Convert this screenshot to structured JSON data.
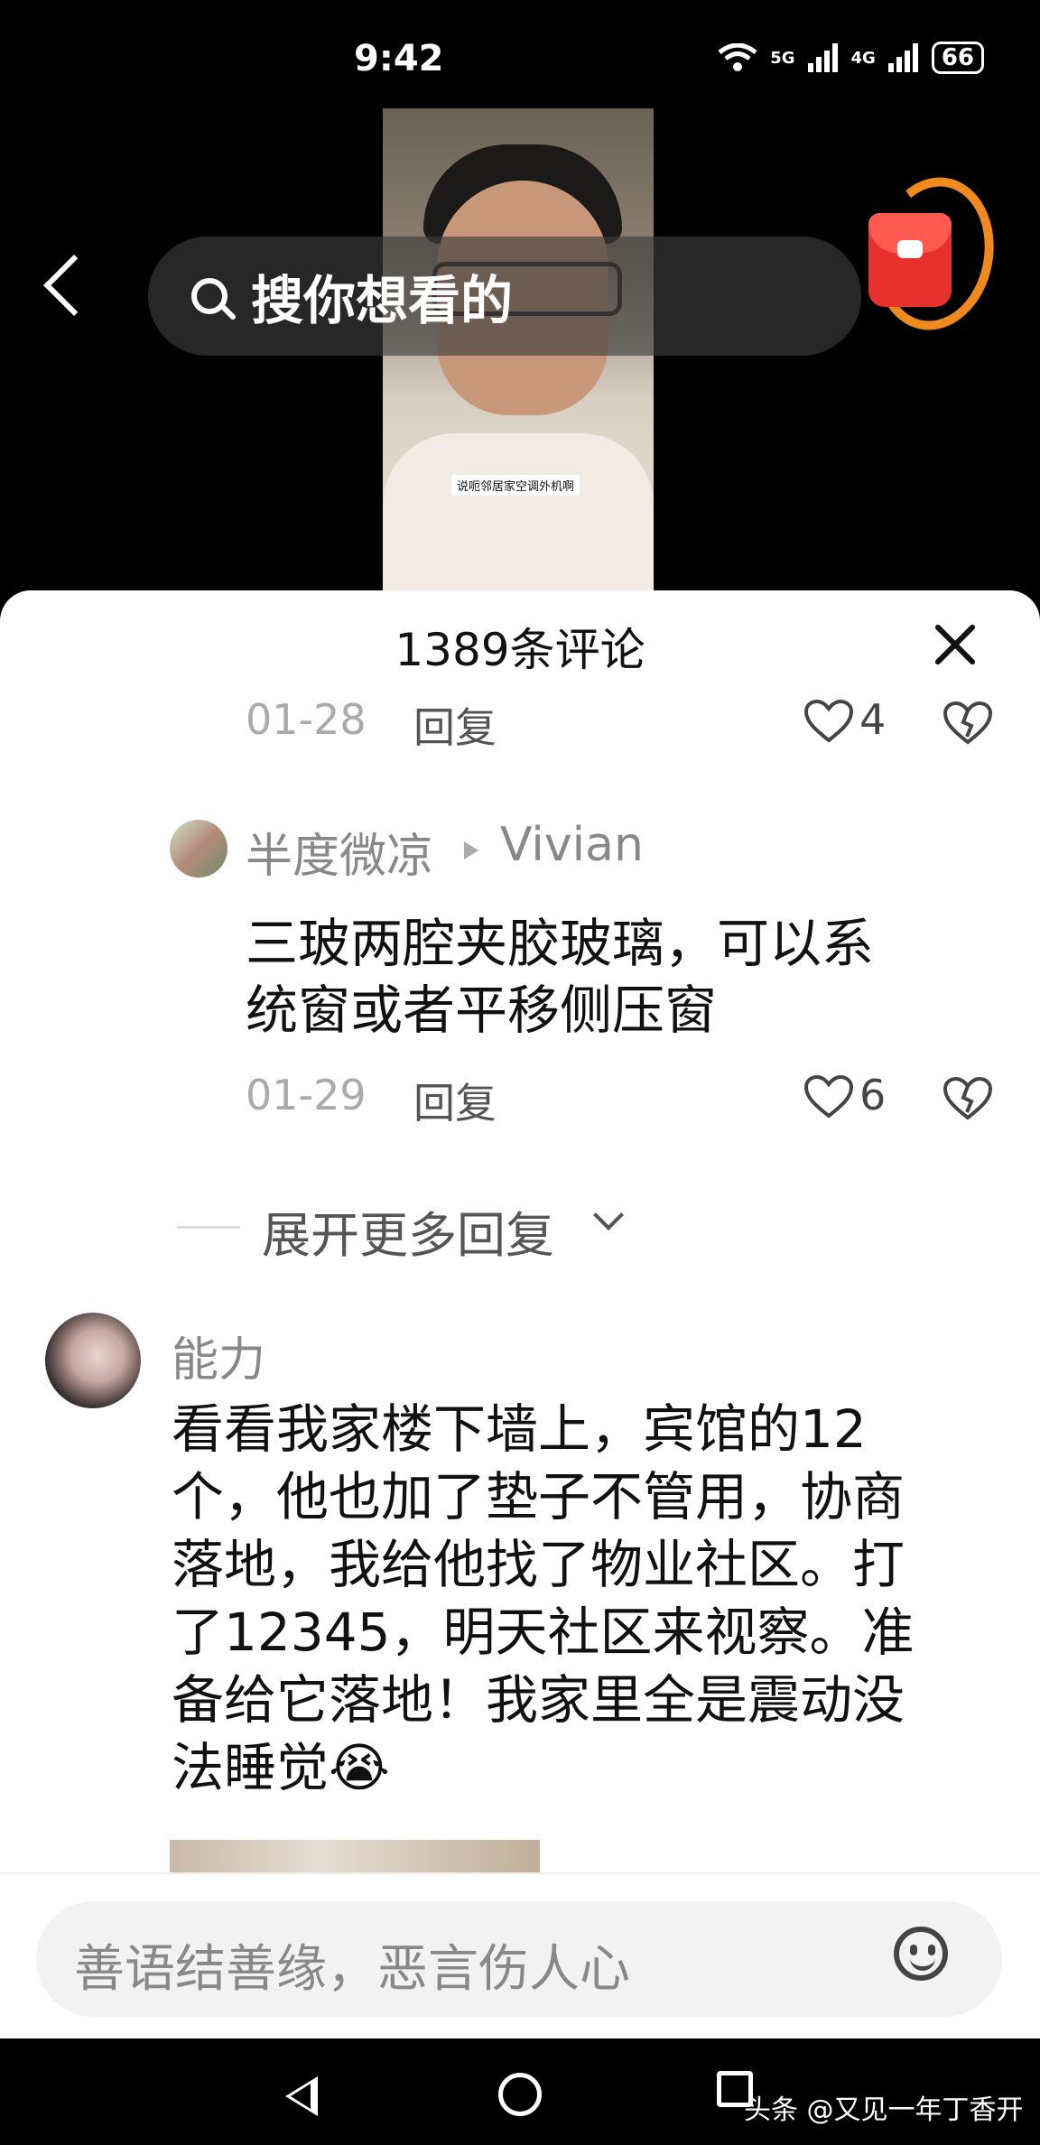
{
  "status_bar": {
    "time": "9:42",
    "net1": "5G",
    "net2": "4G",
    "battery": "66"
  },
  "video": {
    "caption": "说呃邻居家空调外机啊"
  },
  "top_bar": {
    "search_placeholder": "搜你想看的"
  },
  "comments_sheet": {
    "title": "1389条评论",
    "prev_reply": {
      "date": "01-28",
      "reply_label": "回复",
      "likes": "4"
    },
    "reply": {
      "user": "半度微凉",
      "reply_to": "Vivian",
      "text_line1": "三玻两腔夹胶玻璃，可以系",
      "text_line2": "统窗或者平移侧压窗",
      "date": "01-29",
      "reply_label": "回复",
      "likes": "6"
    },
    "expand_label": "展开更多回复",
    "comment": {
      "user": "能力",
      "lines": [
        "看看我家楼下墙上，宾馆的12",
        "个，他也加了垫子不管用，协商",
        "落地，我给他找了物业社区。打",
        "了12345，明天社区来视察。准",
        "备给它落地！我家里全是震动没",
        "法睡觉😭"
      ]
    }
  },
  "input": {
    "placeholder": "善语结善缘，恶言伤人心"
  },
  "nav": {
    "watermark": "头条 @又见一年丁香开"
  }
}
